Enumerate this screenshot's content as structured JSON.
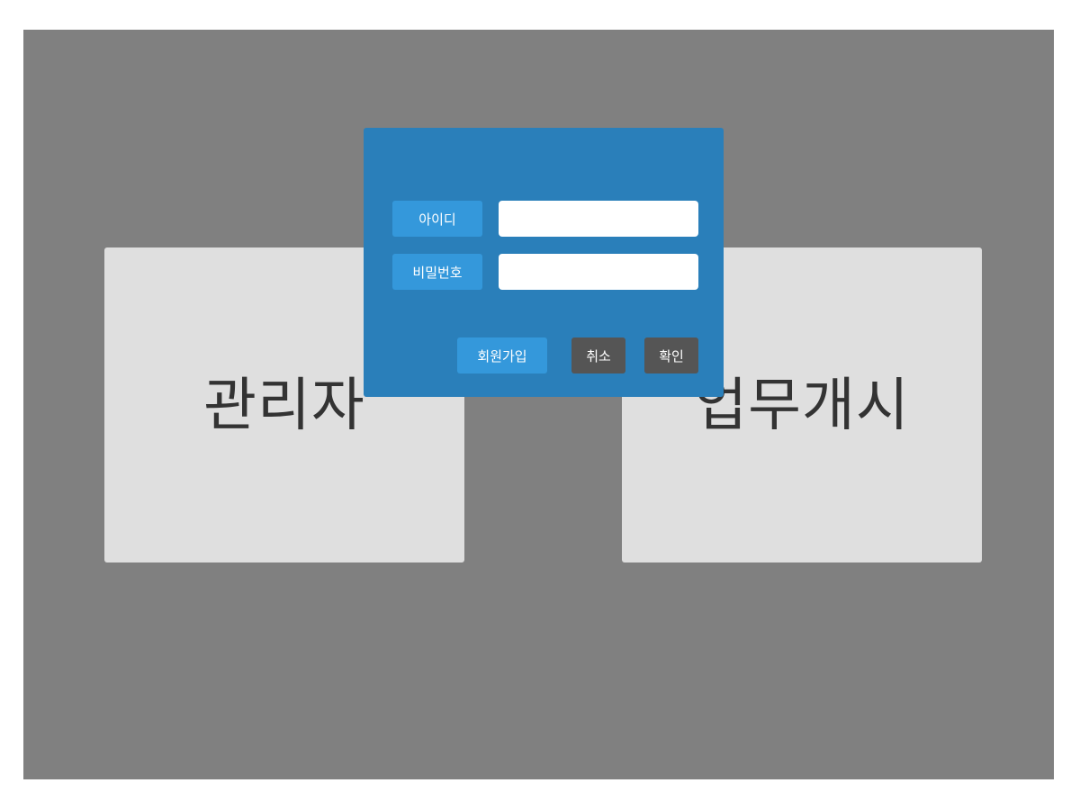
{
  "cards": {
    "admin_label": "관리자",
    "work_label": "업무개시"
  },
  "login_dialog": {
    "id_label": "아이디",
    "id_value": "",
    "password_label": "비밀번호",
    "password_value": "",
    "signup_button": "회원가입",
    "cancel_button": "취소",
    "confirm_button": "확인"
  },
  "colors": {
    "backdrop": "#808080",
    "dialog": "#2a7fba",
    "primary_button": "#3498db",
    "secondary_button": "#555555",
    "card": "#dfdfdf"
  }
}
